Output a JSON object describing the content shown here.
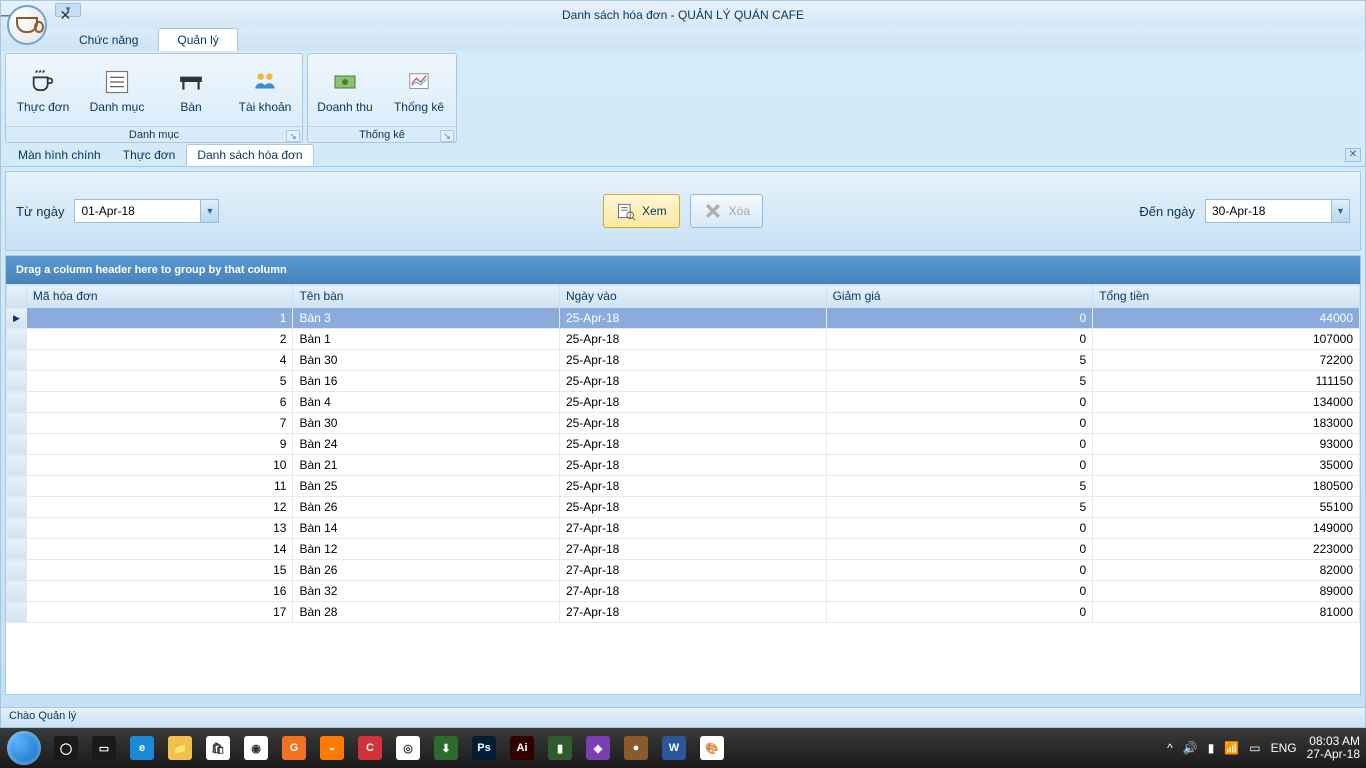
{
  "window_title": "Danh sách hóa đơn - QUẢN LÝ QUÁN CAFE",
  "top_tabs": {
    "chuc_nang": "Chức năng",
    "quan_ly": "Quản lý"
  },
  "ribbon": {
    "danh_muc": {
      "title": "Danh mục",
      "thuc_don": "Thực đơn",
      "danh_muc_item": "Danh mục",
      "ban": "Bàn",
      "tai_khoan": "Tài khoản"
    },
    "thong_ke": {
      "title": "Thống kê",
      "doanh_thu": "Doanh thu",
      "thong_ke_item": "Thống kê"
    }
  },
  "doc_tabs": {
    "man_hinh_chinh": "Màn hình chính",
    "thuc_don": "Thực đơn",
    "danh_sach_hoa_don": "Danh sách hóa đơn"
  },
  "filter": {
    "tu_ngay_label": "Từ ngày",
    "tu_ngay_value": "01-Apr-18",
    "den_ngay_label": "Đến ngày",
    "den_ngay_value": "30-Apr-18",
    "xem": "Xem",
    "xoa": "Xóa"
  },
  "grid": {
    "group_text": "Drag a column header here to group by that column",
    "columns": {
      "ma_hoa_don": "Mã hóa đơn",
      "ten_ban": "Tên bàn",
      "ngay_vao": "Ngày vào",
      "giam_gia": "Giảm giá",
      "tong_tien": "Tổng tiền"
    },
    "rows": [
      {
        "id": "1",
        "ban": "Bàn 3",
        "ngay": "25-Apr-18",
        "giam": "0",
        "tong": "44000"
      },
      {
        "id": "2",
        "ban": "Bàn 1",
        "ngay": "25-Apr-18",
        "giam": "0",
        "tong": "107000"
      },
      {
        "id": "4",
        "ban": "Bàn 30",
        "ngay": "25-Apr-18",
        "giam": "5",
        "tong": "72200"
      },
      {
        "id": "5",
        "ban": "Bàn 16",
        "ngay": "25-Apr-18",
        "giam": "5",
        "tong": "111150"
      },
      {
        "id": "6",
        "ban": "Bàn 4",
        "ngay": "25-Apr-18",
        "giam": "0",
        "tong": "134000"
      },
      {
        "id": "7",
        "ban": "Bàn 30",
        "ngay": "25-Apr-18",
        "giam": "0",
        "tong": "183000"
      },
      {
        "id": "9",
        "ban": "Bàn 24",
        "ngay": "25-Apr-18",
        "giam": "0",
        "tong": "93000"
      },
      {
        "id": "10",
        "ban": "Bàn 21",
        "ngay": "25-Apr-18",
        "giam": "0",
        "tong": "35000"
      },
      {
        "id": "11",
        "ban": "Bàn 25",
        "ngay": "25-Apr-18",
        "giam": "5",
        "tong": "180500"
      },
      {
        "id": "12",
        "ban": "Bàn 26",
        "ngay": "25-Apr-18",
        "giam": "5",
        "tong": "55100"
      },
      {
        "id": "13",
        "ban": "Bàn 14",
        "ngay": "27-Apr-18",
        "giam": "0",
        "tong": "149000"
      },
      {
        "id": "14",
        "ban": "Bàn 12",
        "ngay": "27-Apr-18",
        "giam": "0",
        "tong": "223000"
      },
      {
        "id": "15",
        "ban": "Bàn 26",
        "ngay": "27-Apr-18",
        "giam": "0",
        "tong": "82000"
      },
      {
        "id": "16",
        "ban": "Bàn 32",
        "ngay": "27-Apr-18",
        "giam": "0",
        "tong": "89000"
      },
      {
        "id": "17",
        "ban": "Bàn 28",
        "ngay": "27-Apr-18",
        "giam": "0",
        "tong": "81000"
      }
    ]
  },
  "statusbar": "Chào Quản lý",
  "tray": {
    "lang": "ENG",
    "time": "08:03 AM",
    "date": "27-Apr-18"
  },
  "task_icons": [
    {
      "name": "cortana",
      "color": "#1a1a1a",
      "glyph": "◯"
    },
    {
      "name": "taskview",
      "color": "#1a1a1a",
      "glyph": "▭"
    },
    {
      "name": "edge",
      "color": "#1a89d8",
      "glyph": "e"
    },
    {
      "name": "explorer",
      "color": "#f0c24b",
      "glyph": "📁"
    },
    {
      "name": "store",
      "color": "#ffffff",
      "glyph": "🛍"
    },
    {
      "name": "chrome",
      "color": "#ffffff",
      "glyph": "◉"
    },
    {
      "name": "app1",
      "color": "#f36f21",
      "glyph": "G"
    },
    {
      "name": "avast",
      "color": "#ff7a00",
      "glyph": "◒"
    },
    {
      "name": "ccleaner",
      "color": "#d13438",
      "glyph": "C"
    },
    {
      "name": "teamviewer",
      "color": "#ffffff",
      "glyph": "◎"
    },
    {
      "name": "idm",
      "color": "#2d6b2d",
      "glyph": "⬇"
    },
    {
      "name": "photoshop",
      "color": "#001e36",
      "glyph": "Ps"
    },
    {
      "name": "illustrator",
      "color": "#330000",
      "glyph": "Ai"
    },
    {
      "name": "corel",
      "color": "#2f5a2f",
      "glyph": "▮"
    },
    {
      "name": "visualstudio",
      "color": "#7a3fb5",
      "glyph": "◈"
    },
    {
      "name": "app-brown",
      "color": "#8b5a2b",
      "glyph": "●"
    },
    {
      "name": "word",
      "color": "#2b579a",
      "glyph": "W"
    },
    {
      "name": "paint",
      "color": "#ffffff",
      "glyph": "🎨"
    }
  ]
}
